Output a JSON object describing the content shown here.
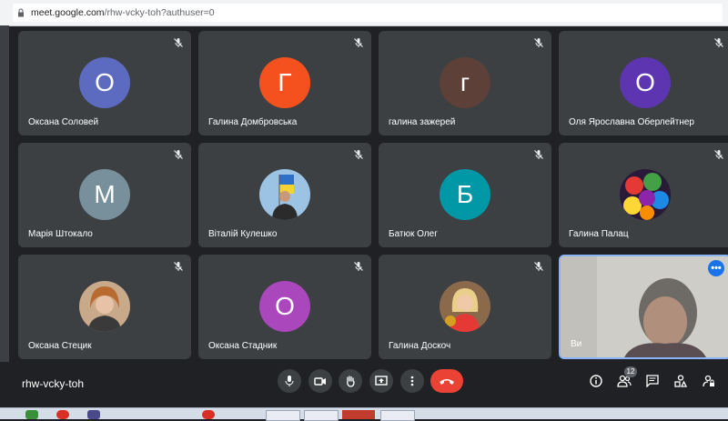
{
  "browser": {
    "url_host": "meet.google.com",
    "url_path": "/rhw-vcky-toh?authuser=0"
  },
  "tiles": [
    {
      "name": "Оксана Соловей",
      "initial": "О",
      "color": "#5c6bc0"
    },
    {
      "name": "Галина Домбровська",
      "initial": "Г",
      "color": "#f4511e"
    },
    {
      "name": "галина зажерей",
      "initial": "г",
      "color": "#5d4037"
    },
    {
      "name": "Оля Ярославна Оберлейтнер",
      "initial": "О",
      "color": "#5e35b1"
    },
    {
      "name": "Марія Штокало",
      "initial": "М",
      "color": "#78909c"
    },
    {
      "name": "Віталій Кулешко",
      "photo": "man-with-flag"
    },
    {
      "name": "Батюк Олег",
      "initial": "Б",
      "color": "#0097a7"
    },
    {
      "name": "Галина Палац",
      "photo": "colorful-flowers"
    },
    {
      "name": "Оксана Стецик",
      "photo": "woman-portrait"
    },
    {
      "name": "Оксана Стадник",
      "initial": "О",
      "color": "#ab47bc"
    },
    {
      "name": "Галина Доскоч",
      "photo": "woman-red-dress"
    },
    {
      "name": "Ви",
      "self": true
    }
  ],
  "meeting": {
    "code": "rhw-vcky-toh",
    "participants_count": "12"
  },
  "colors": {
    "background": "#202124",
    "tile": "#3c4043",
    "end_call": "#ea4335",
    "accent": "#1a73e8"
  }
}
